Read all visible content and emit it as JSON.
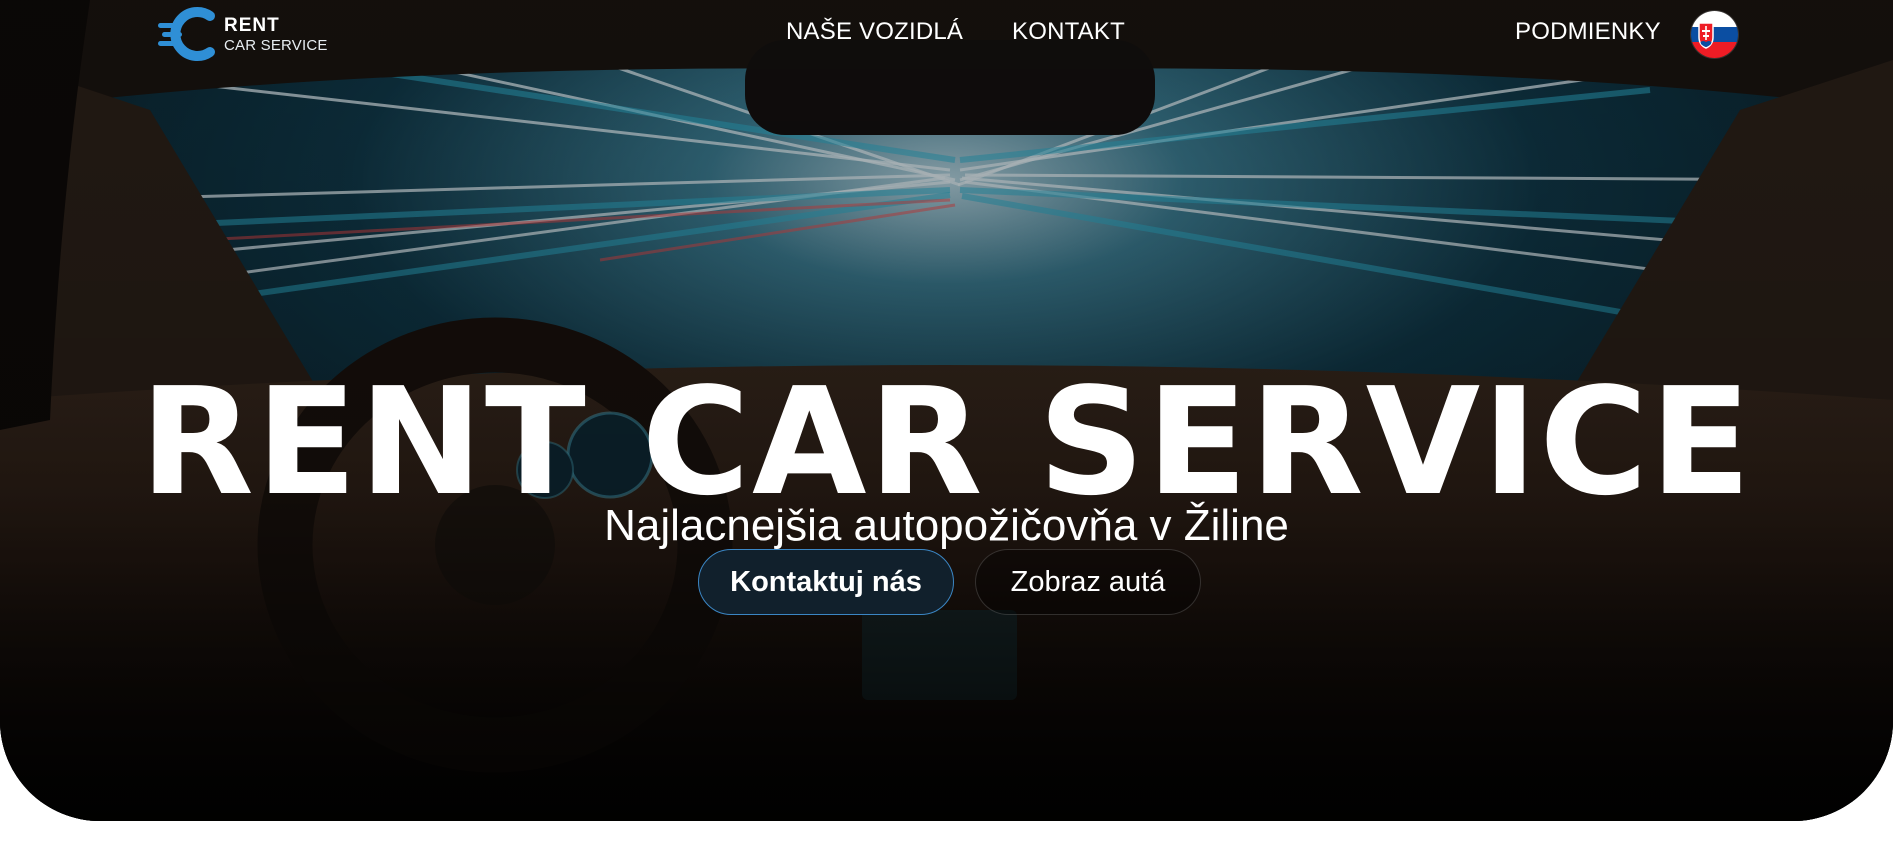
{
  "brand": {
    "logo_rent": "RENT",
    "logo_sub": "CAR SERVICE",
    "accent_color": "#2f8fd6"
  },
  "nav": {
    "vehicles": "NAŠE VOZIDLÁ",
    "contact": "KONTAKT",
    "terms": "PODMIENKY",
    "language_flag": "slovakia-flag-icon"
  },
  "hero": {
    "title": "RENT CAR SERVICE",
    "subtitle": "Najlacnejšia autopožičovňa v Žiline",
    "primary_button": "Kontaktuj nás",
    "secondary_button": "Zobraz autá"
  }
}
